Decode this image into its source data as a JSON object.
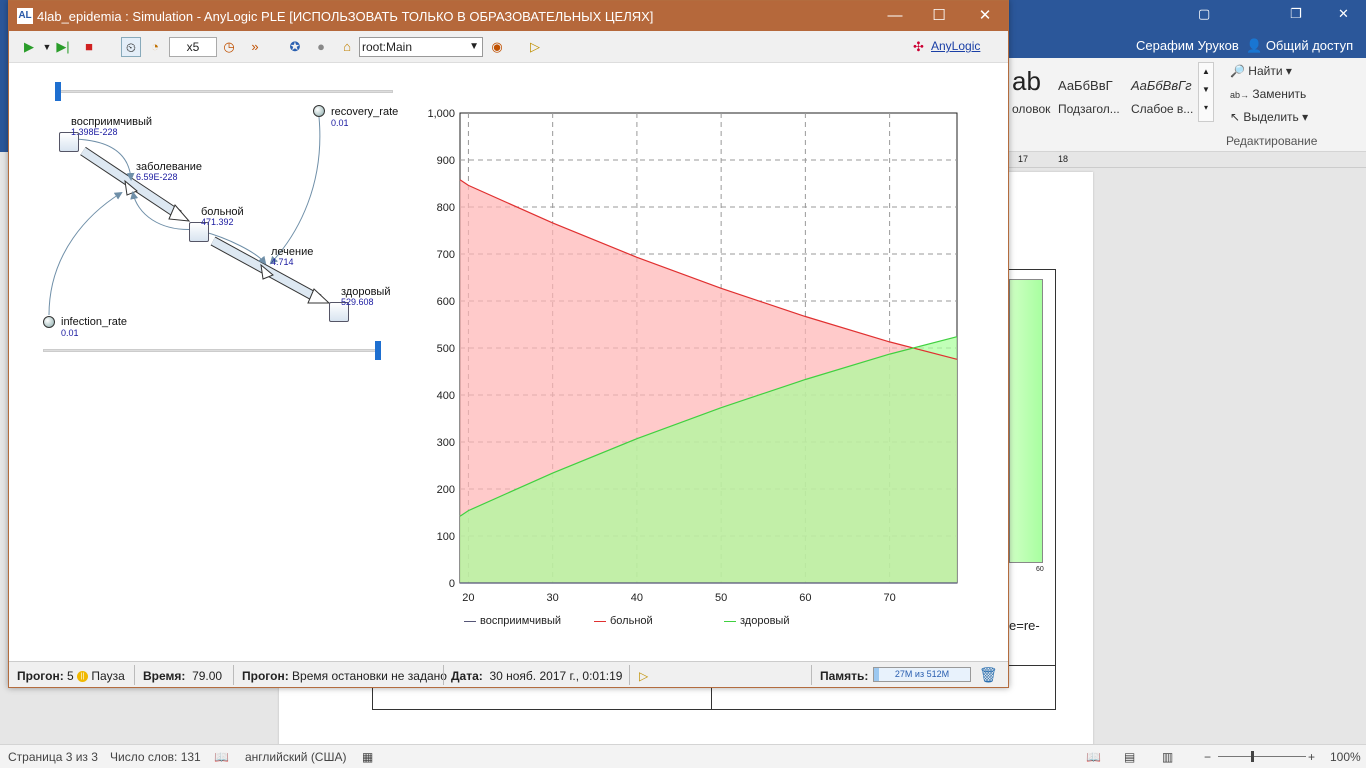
{
  "word": {
    "user": "Серафим Уруков",
    "share": "Общий доступ",
    "styles": [
      {
        "sample": "ab",
        "name": "оловок"
      },
      {
        "sample": "АаБбВвГ",
        "name": "Подзагол..."
      },
      {
        "sample": "АаБбВвГг",
        "name": "Слабое в..."
      }
    ],
    "edit": {
      "find": "Найти",
      "replace": "Заменить",
      "select": "Выделить",
      "group": "Редактирование"
    },
    "ruler_marks": [
      "17",
      "18"
    ],
    "doc_fragment": "e=re-",
    "side_axis_tick": "60",
    "status": {
      "page": "Страница 3 из 3",
      "words": "Число слов: 131",
      "language": "английский (США)",
      "zoom": "100%"
    }
  },
  "anylogic": {
    "title": "4lab_epidemia : Simulation - AnyLogic PLE [ИСПОЛЬЗОВАТЬ ТОЛЬКО В ОБРАЗОВАТЕЛЬНЫХ ЦЕЛЯХ]",
    "toolbar": {
      "speed": "x5",
      "root": "root:Main",
      "link": "AnyLogic"
    },
    "diagram": {
      "stocks": [
        {
          "name": "восприимчивый",
          "value": "1.398E-228"
        },
        {
          "name": "больной",
          "value": "471.392"
        },
        {
          "name": "здоровый",
          "value": "529.608"
        }
      ],
      "flows": [
        {
          "name": "заболевание",
          "value": "6.59E-228"
        },
        {
          "name": "лечение",
          "value": "4.714"
        }
      ],
      "params": [
        {
          "name": "recovery_rate",
          "value": "0.01"
        },
        {
          "name": "infection_rate",
          "value": "0.01"
        }
      ],
      "slider_top": 0.0,
      "slider_bottom": 1.0
    },
    "status": {
      "run_label": "Прогон:",
      "run_value": "5",
      "pause": "Пауза",
      "time_label": "Время:",
      "time_value": "79.00",
      "run2_label": "Прогон:",
      "run2_value": "Время остановки не задано",
      "date_label": "Дата:",
      "date_value": "30 нояб. 2017 г., 0:01:19",
      "memory_label": "Память:",
      "memory_value": "27M из 512M",
      "memory_used_fraction": 0.053
    }
  },
  "chart_data": {
    "type": "area",
    "xlim": [
      19,
      78
    ],
    "ylim": [
      0,
      1000
    ],
    "xticks": [
      20,
      30,
      40,
      50,
      60,
      70
    ],
    "yticks": [
      "0",
      "100",
      "200",
      "300",
      "400",
      "500",
      "600",
      "700",
      "800",
      "900",
      "1,000"
    ],
    "grid": true,
    "legend_position": "bottom",
    "series": [
      {
        "name": "восприимчивый",
        "color": "#555577",
        "x": [
          19,
          30,
          40,
          50,
          60,
          70,
          78
        ],
        "y": [
          0,
          0,
          0,
          0,
          0,
          0,
          0
        ]
      },
      {
        "name": "больной",
        "color": "#e03030",
        "fill": "#ffb3b3",
        "x": [
          19,
          20,
          30,
          40,
          50,
          60,
          70,
          78
        ],
        "y": [
          858,
          846,
          766,
          693,
          627,
          567,
          513,
          476
        ]
      },
      {
        "name": "здоровый",
        "color": "#40d040",
        "fill": "#a8ff9a",
        "x": [
          19,
          20,
          30,
          40,
          50,
          60,
          70,
          78
        ],
        "y": [
          142,
          154,
          234,
          307,
          373,
          433,
          487,
          524
        ]
      }
    ]
  }
}
